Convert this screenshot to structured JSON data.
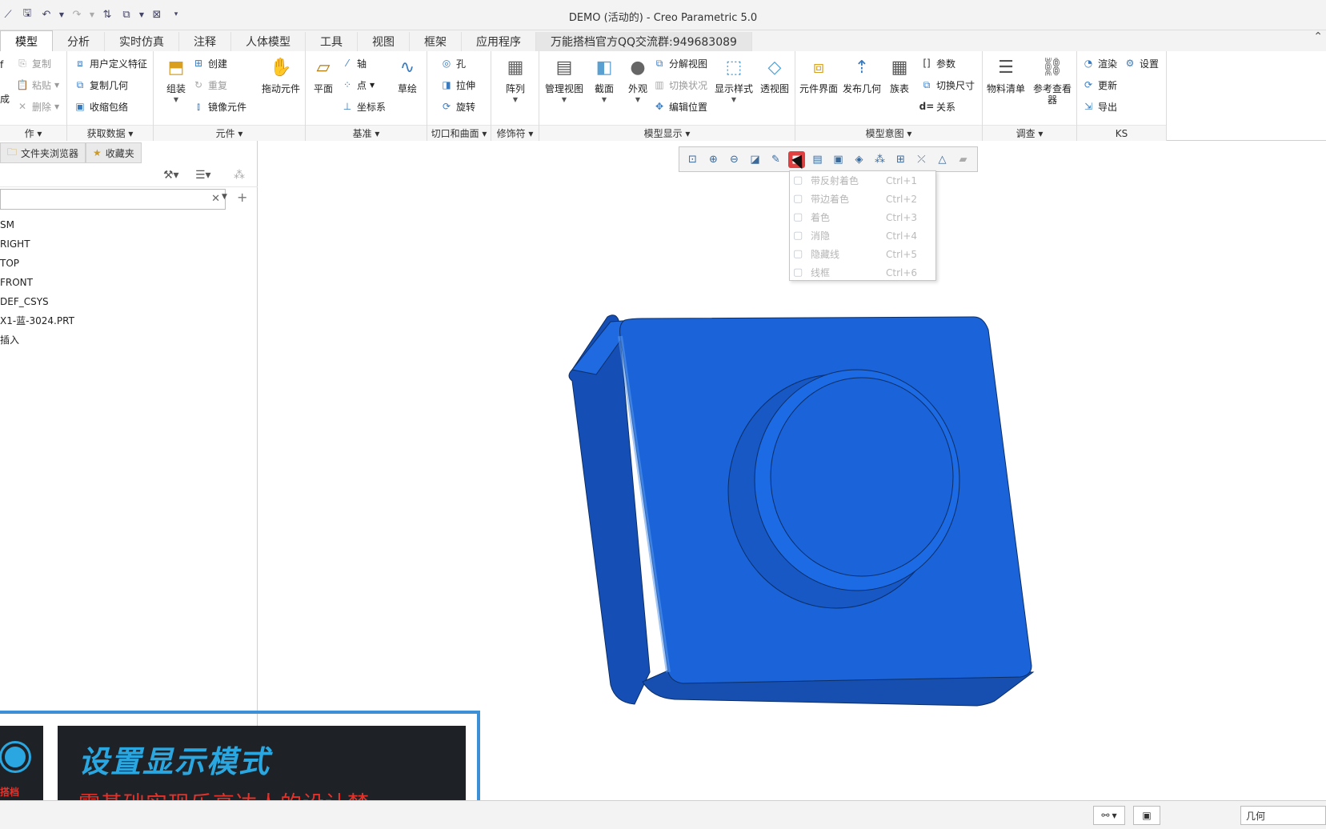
{
  "window": {
    "title": "DEMO (活动的) - Creo Parametric 5.0"
  },
  "qat": {
    "icons": [
      "new-icon",
      "save-icon",
      "undo-icon",
      "redo-icon",
      "regenerate-icon",
      "windows-icon",
      "close-window-icon",
      "customize-icon"
    ]
  },
  "tabs": [
    {
      "label": "模型",
      "active": true
    },
    {
      "label": "分析"
    },
    {
      "label": "实时仿真"
    },
    {
      "label": "注释"
    },
    {
      "label": "人体模型"
    },
    {
      "label": "工具"
    },
    {
      "label": "视图"
    },
    {
      "label": "框架"
    },
    {
      "label": "应用程序"
    },
    {
      "label": "万能搭档官方QQ交流群:949683089"
    }
  ],
  "ribbon": {
    "operations": {
      "label": "作",
      "items": [
        "复制",
        "粘贴",
        "删除"
      ],
      "left_cut": [
        "f",
        "成"
      ]
    },
    "get_data": {
      "label": "获取数据",
      "items": [
        "用户定义特征",
        "复制几何",
        "收缩包络"
      ]
    },
    "component": {
      "label": "元件",
      "assemble": "组装",
      "items": [
        "创建",
        "重复",
        "镜像元件"
      ],
      "drag": "拖动元件"
    },
    "datum": {
      "label": "基准",
      "plane": "平面",
      "items": [
        "轴",
        "点",
        "坐标系"
      ],
      "sketch": "草绘"
    },
    "cut_surface": {
      "label": "切口和曲面",
      "items": [
        "孔",
        "拉伸",
        "旋转"
      ]
    },
    "modifiers": {
      "label": "修饰符",
      "pattern": "阵列"
    },
    "model_display": {
      "label": "模型显示",
      "manage_views": "管理视图",
      "section": "截面",
      "appearance": "外观",
      "items": [
        "分解视图",
        "切换状况",
        "编辑位置"
      ],
      "display_style": "显示样式",
      "perspective": "透视图"
    },
    "model_intent": {
      "label": "模型意图",
      "component_interface": "元件界面",
      "publish_geometry": "发布几何",
      "family_table": "族表",
      "items": [
        "参数",
        "切换尺寸",
        "关系"
      ],
      "relations_prefix": "d="
    },
    "investigate": {
      "label": "调查",
      "bom": "物料清单",
      "ref_viewer": "参考查看器"
    },
    "ks": {
      "label": "KS",
      "items": [
        "渲染",
        "设置",
        "更新",
        "导出"
      ]
    }
  },
  "left_panel": {
    "tabs": [
      "文件夹浏览器",
      "收藏夹"
    ],
    "search": {
      "value": "",
      "placeholder": ""
    },
    "tree": [
      "SM",
      "RIGHT",
      "TOP",
      "FRONT",
      "DEF_CSYS",
      "X1-蓝-3024.PRT",
      "插入"
    ]
  },
  "view_toolbar": {
    "icons": [
      "refit-icon",
      "zoom-in-icon",
      "zoom-out-icon",
      "repaint-icon",
      "spin-center-icon",
      "display-style-icon",
      "saved-views-icon",
      "named-views-icon",
      "section-icon",
      "datum-display-icon",
      "annotation-display-icon",
      "perspective-icon",
      "spin-icon",
      "appearance-icon",
      "plane-display-icon"
    ]
  },
  "display_style_menu": {
    "items": [
      {
        "label": "带反射着色",
        "shortcut": "Ctrl+1"
      },
      {
        "label": "带边着色",
        "shortcut": "Ctrl+2"
      },
      {
        "label": "着色",
        "shortcut": "Ctrl+3"
      },
      {
        "label": "消隐",
        "shortcut": "Ctrl+4"
      },
      {
        "label": "隐藏线",
        "shortcut": "Ctrl+5"
      },
      {
        "label": "线框",
        "shortcut": "Ctrl+6"
      }
    ]
  },
  "model": {
    "color": "#1a63d8",
    "edge_color": "#0b2e66"
  },
  "overlay": {
    "title": "设置显示模式",
    "subtitle": "零基础实现乐高达人的设计梦",
    "logo_text": "搭档"
  },
  "status": {
    "filter": "几何"
  }
}
